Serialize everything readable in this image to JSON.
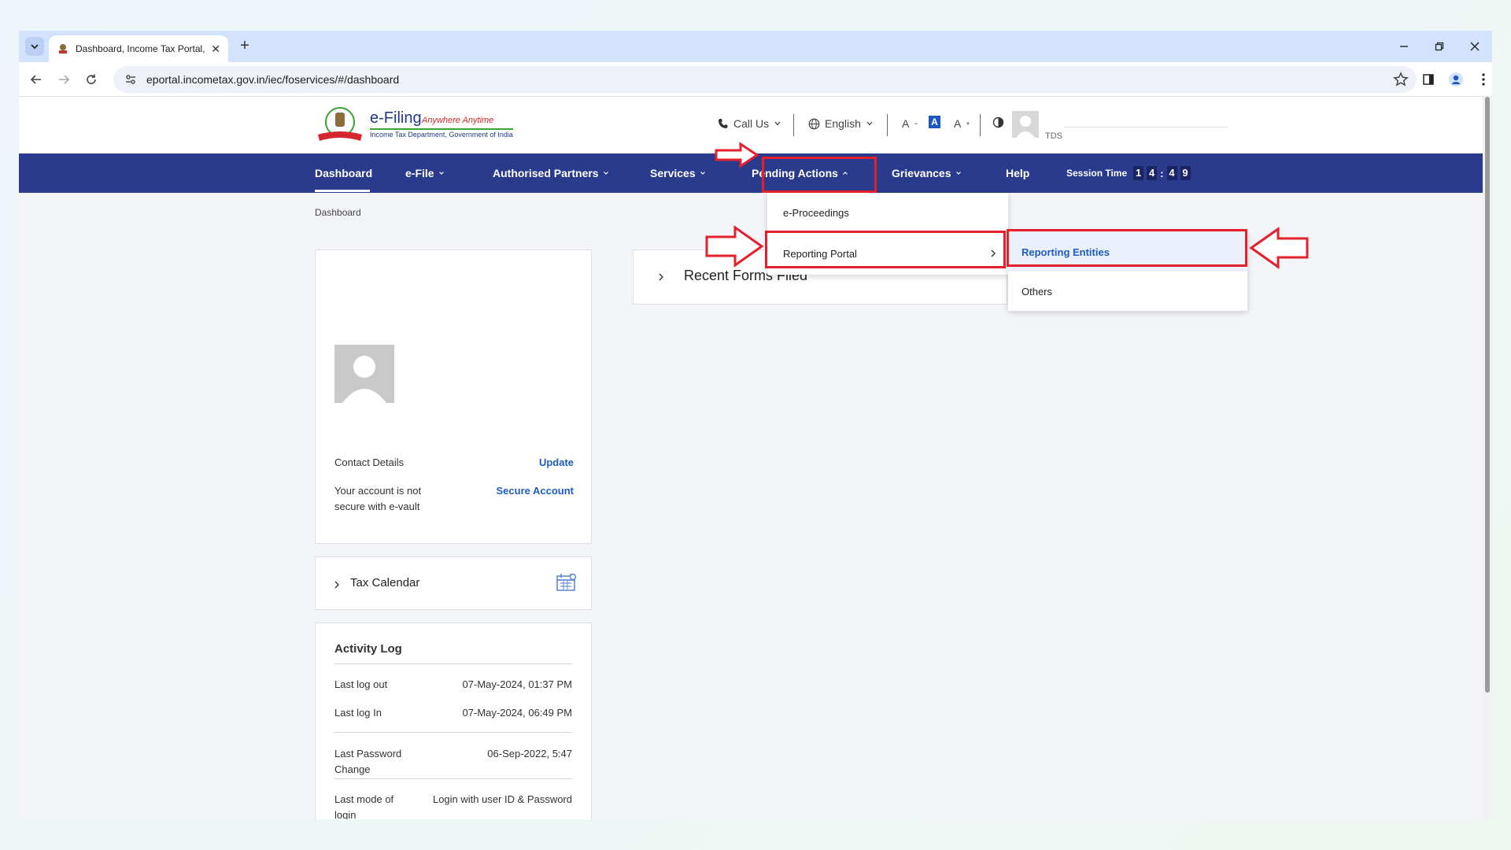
{
  "browser": {
    "tab_title": "Dashboard, Income Tax Portal, (",
    "url": "eportal.incometax.gov.in/iec/foservices/#/dashboard"
  },
  "site": {
    "brand": "e-Filing",
    "tagline": "Anywhere Anytime",
    "dept": "Income Tax Department, Government of India",
    "call_us": "Call Us",
    "language": "English",
    "font_decrease": "A",
    "font_normal": "A",
    "font_increase": "A",
    "user_role": "TDS"
  },
  "nav": {
    "dashboard": "Dashboard",
    "efile": "e-File",
    "authorised_partners": "Authorised Partners",
    "services": "Services",
    "pending_actions": "Pending Actions",
    "grievances": "Grievances",
    "help": "Help",
    "session_label": "Session Time",
    "session_digits": [
      "1",
      "4",
      "4",
      "9"
    ]
  },
  "breadcrumb": "Dashboard",
  "profile": {
    "contact_label": "Contact Details",
    "update_link": "Update",
    "evault_text": "Your account is not secure with e-vault",
    "secure_link": "Secure Account"
  },
  "tax_calendar": "Tax Calendar",
  "activity": {
    "heading": "Activity Log",
    "rows": [
      {
        "label": "Last log out",
        "value": "07-May-2024, 01:37 PM"
      },
      {
        "label": "Last log In",
        "value": "07-May-2024, 06:49 PM"
      },
      {
        "label": "Last Password Change",
        "value": "06-Sep-2022, 5:47"
      },
      {
        "label": "Last mode of login",
        "value": "Login with user ID & Password"
      }
    ]
  },
  "recent_forms": "Recent Forms Filed",
  "pending_menu": {
    "items": [
      "e-Proceedings",
      "Reporting Portal"
    ]
  },
  "reporting_menu": {
    "items": [
      "Reporting Entities",
      "Others"
    ]
  },
  "colors": {
    "nav_bg": "#2a3a8c",
    "link": "#1f5cbf",
    "annotation": "#e3202b"
  }
}
